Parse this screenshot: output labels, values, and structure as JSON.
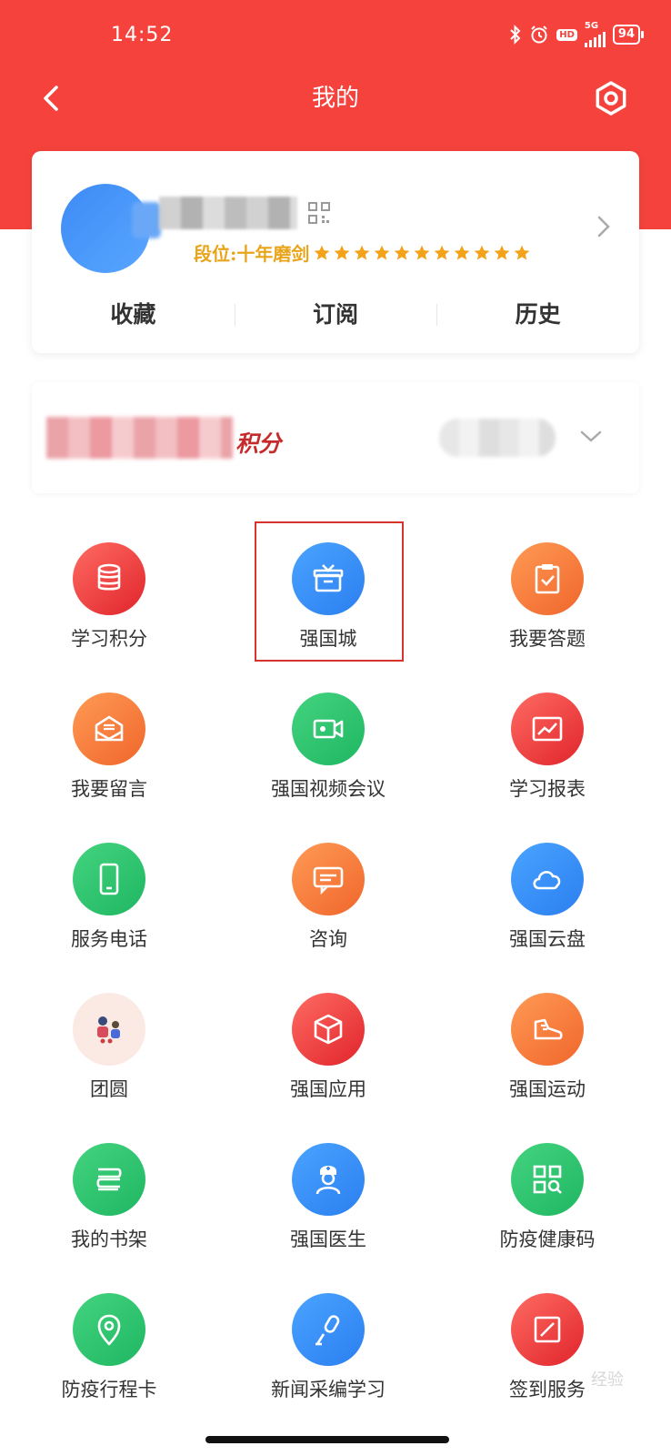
{
  "status_bar": {
    "time": "14:52",
    "network": "5G",
    "hd_label": "HD",
    "battery": "94",
    "icons": [
      "bluetooth-icon",
      "alarm-icon",
      "hd-icon",
      "signal-icon",
      "battery-icon"
    ]
  },
  "nav": {
    "title": "我的",
    "back_icon": "chevron-left-icon",
    "settings_icon": "settings-gear-icon"
  },
  "profile": {
    "rank_label": "段位:十年磨剑",
    "star_count": 11,
    "tabs": [
      {
        "label": "收藏"
      },
      {
        "label": "订阅"
      },
      {
        "label": "历史"
      }
    ]
  },
  "points": {
    "label": "积分"
  },
  "grid": {
    "highlight_index": 1,
    "items": [
      {
        "label": "学习积分",
        "icon": "coins-stack-icon",
        "color": "#e9353a"
      },
      {
        "label": "强国城",
        "icon": "gift-box-icon",
        "color": "#2f86f2"
      },
      {
        "label": "我要答题",
        "icon": "clipboard-check-icon",
        "color": "#f26d34"
      },
      {
        "label": "我要留言",
        "icon": "envelope-icon",
        "color": "#f26d34"
      },
      {
        "label": "强国视频会议",
        "icon": "video-camera-icon",
        "color": "#26bd68"
      },
      {
        "label": "学习报表",
        "icon": "chart-trend-icon",
        "color": "#e9353a"
      },
      {
        "label": "服务电话",
        "icon": "phone-icon",
        "color": "#26bd68"
      },
      {
        "label": "咨询",
        "icon": "chat-bubbles-icon",
        "color": "#f26d34"
      },
      {
        "label": "强国云盘",
        "icon": "cloud-icon",
        "color": "#2f86f2"
      },
      {
        "label": "团圆",
        "icon": "family-reunion-icon",
        "color": "#fbe9e4"
      },
      {
        "label": "强国应用",
        "icon": "cube-icon",
        "color": "#e9353a"
      },
      {
        "label": "强国运动",
        "icon": "sneaker-icon",
        "color": "#f26d34"
      },
      {
        "label": "我的书架",
        "icon": "books-icon",
        "color": "#26bd68"
      },
      {
        "label": "强国医生",
        "icon": "doctor-icon",
        "color": "#2f86f2"
      },
      {
        "label": "防疫健康码",
        "icon": "qr-scan-icon",
        "color": "#26bd68"
      },
      {
        "label": "防疫行程卡",
        "icon": "location-pin-icon",
        "color": "#26bd68"
      },
      {
        "label": "新闻采编学习",
        "icon": "microphone-icon",
        "color": "#2f86f2"
      },
      {
        "label": "签到服务",
        "icon": "sign-pen-icon",
        "color": "#e9353a"
      }
    ]
  },
  "watermark": "经验"
}
